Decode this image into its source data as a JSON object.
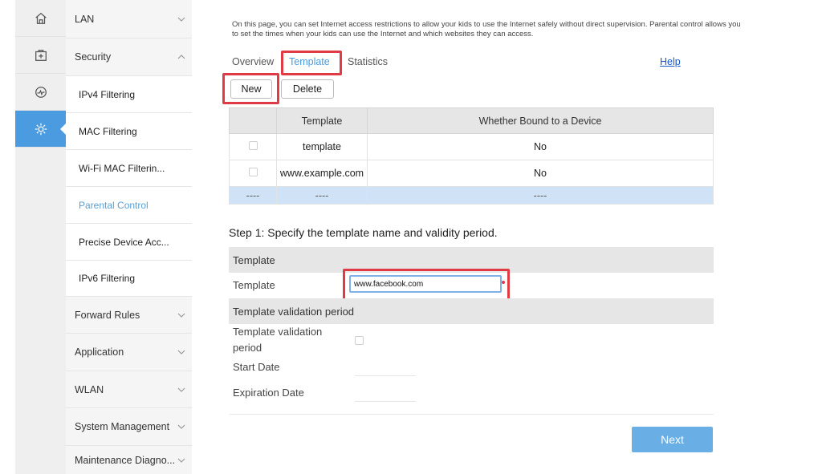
{
  "rail": [
    {
      "icon": "home-icon"
    },
    {
      "icon": "medkit-icon"
    },
    {
      "icon": "gauge-icon"
    },
    {
      "icon": "gear-icon",
      "active": true
    }
  ],
  "menu": {
    "lan": "LAN",
    "security": "Security",
    "ipv4_filtering": "IPv4 Filtering",
    "mac_filtering": "MAC Filtering",
    "wifi_mac_filtering": "Wi-Fi MAC Filterin...",
    "parental_control": "Parental Control",
    "precise_device_access": "Precise Device Acc...",
    "ipv6_filtering": "IPv6 Filtering",
    "forward_rules": "Forward Rules",
    "application": "Application",
    "wlan": "WLAN",
    "system_management": "System Management",
    "maintenance_diagnosis": "Maintenance Diagno..."
  },
  "description": "On this page, you can set Internet access restrictions to allow your kids to use the Internet safely without direct supervision. Parental control allows you to set the times when your kids can use the Internet and which websites they can access.",
  "tabs": {
    "overview": "Overview",
    "template": "Template",
    "statistics": "Statistics",
    "help": "Help"
  },
  "actions": {
    "new": "New",
    "delete": "Delete"
  },
  "table": {
    "col_template": "Template",
    "col_bound": "Whether Bound to a Device",
    "rows": [
      {
        "template": "template",
        "bound": "No"
      },
      {
        "template": "www.example.com",
        "bound": "No"
      }
    ],
    "empty_row": [
      "----",
      "----",
      "----"
    ]
  },
  "step1": "Step 1: Specify the template name and validity period.",
  "form": {
    "section_template": "Template",
    "template_label": "Template",
    "template_value": "www.facebook.com",
    "section_validation": "Template validation period",
    "validation_label_line1": "Template validation",
    "validation_label_line2": "period",
    "start_date_label": "Start Date",
    "expiration_date_label": "Expiration Date"
  },
  "next": "Next",
  "colors": {
    "accent": "#4a9be0",
    "highlight": "#e03a45",
    "next_button": "#6aaee6"
  }
}
